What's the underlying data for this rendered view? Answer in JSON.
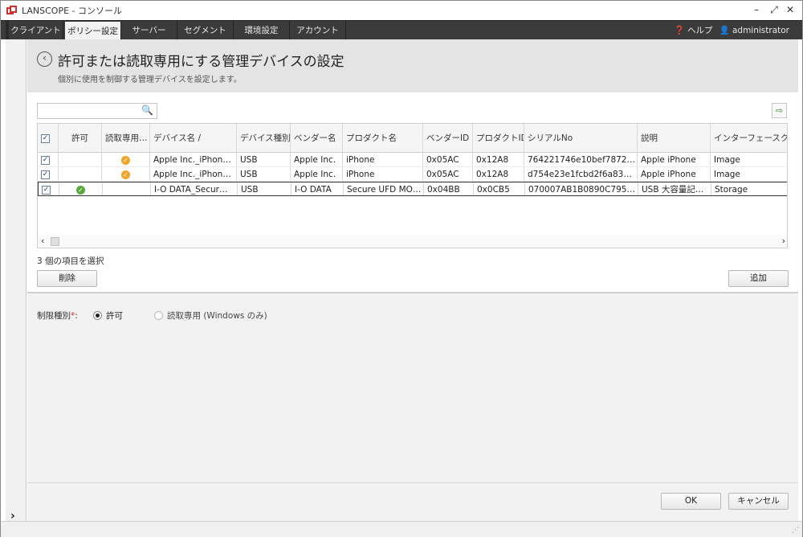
{
  "window": {
    "title": "LANSCOPE - コンソール",
    "controls": [
      "minimize-icon",
      "maximize-icon",
      "close-icon"
    ]
  },
  "menu": {
    "tabs": [
      {
        "label": "クライアント",
        "active": false
      },
      {
        "label": "ポリシー設定",
        "active": true
      },
      {
        "label": "サーバー",
        "active": false
      },
      {
        "label": "セグメント",
        "active": false
      },
      {
        "label": "環境設定",
        "active": false
      },
      {
        "label": "アカウント",
        "active": false
      }
    ],
    "help": "ヘルプ",
    "user": "administrator"
  },
  "header": {
    "title": "許可または読取専用にする管理デバイスの設定",
    "subtitle": "個別に使用を制御する管理デバイスを設定します。"
  },
  "table": {
    "columns": [
      "",
      "許可",
      "読取専用…",
      "デバイス名 /",
      "デバイス種別",
      "ベンダー名",
      "プロダクト名",
      "ベンダーID",
      "プロダクトID",
      "シリアルNo",
      "説明",
      "インターフェースクラス"
    ],
    "rows": [
      {
        "checked": true,
        "allow": false,
        "readonly": true,
        "device": "Apple Inc._iPhon…",
        "type": "USB",
        "vendor": "Apple Inc.",
        "product": "iPhone",
        "vendor_id": "0x05AC",
        "product_id": "0x12A8",
        "serial": "764221746e10bef7872…",
        "desc": "Apple iPhone",
        "iface": "Image"
      },
      {
        "checked": true,
        "allow": false,
        "readonly": true,
        "device": "Apple Inc._iPhon…",
        "type": "USB",
        "vendor": "Apple Inc.",
        "product": "iPhone",
        "vendor_id": "0x05AC",
        "product_id": "0x12A8",
        "serial": "d754e23e1fcbd2f6a83…",
        "desc": "Apple iPhone",
        "iface": "Image"
      },
      {
        "checked": true,
        "allow": true,
        "readonly": false,
        "device": "I-O DATA_Secur…",
        "type": "USB",
        "vendor": "I-O DATA",
        "product": "Secure UFD MO…",
        "vendor_id": "0x04BB",
        "product_id": "0x0CB5",
        "serial": "070007AB1B0890C795…",
        "desc": "USB 大容量記…",
        "iface": "Storage"
      }
    ],
    "selected_count_text": "3 個の項目を選択"
  },
  "buttons": {
    "delete": "削除",
    "add": "追加",
    "ok": "OK",
    "cancel": "キャンセル"
  },
  "restriction": {
    "label": "制限種別",
    "required_mark": "*",
    "colon": ":",
    "options": [
      {
        "label": "許可",
        "selected": true,
        "enabled": true
      },
      {
        "label": "読取専用 (Windows のみ)",
        "selected": false,
        "enabled": false
      }
    ]
  },
  "colors": {
    "menubar": "#3b3b3b",
    "header_bg": "#e4e4e4",
    "readonly_dot": "#f0a52a",
    "allow_dot": "#5aa83a"
  }
}
